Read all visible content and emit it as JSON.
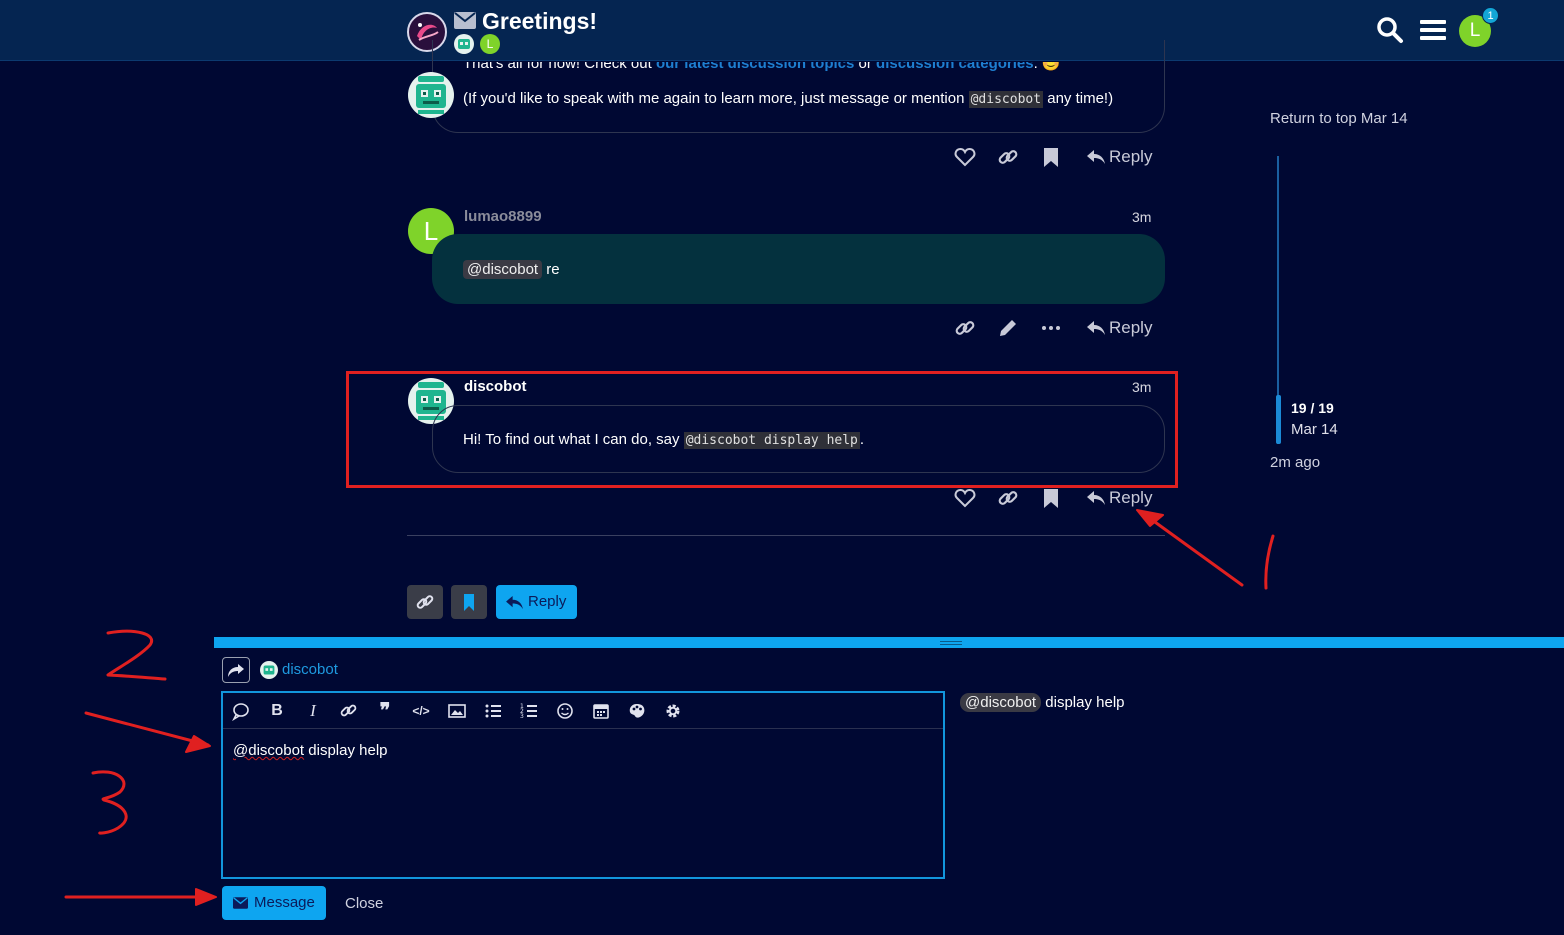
{
  "header": {
    "topic_title": "Greetings!",
    "participant_initial": "L",
    "user_initial": "L",
    "notification_count": "1",
    "icons": [
      "logo",
      "envelope-icon",
      "search-icon",
      "hamburger-menu-icon"
    ]
  },
  "posts": {
    "first": {
      "line1_prefix": "That's all for now! Check out ",
      "line1_link1": "our latest discussion topics",
      "line1_mid": " or ",
      "line1_link2": "discussion categories",
      "line1_suffix": ". 😊",
      "line2_prefix": "(If you'd like to speak with me again to learn more, just message or mention ",
      "line2_code": "@discobot",
      "line2_suffix": " any time!)",
      "reply_label": "Reply"
    },
    "second": {
      "username": "lumao8899",
      "avatar_initial": "L",
      "age": "3m",
      "mention": "@discobot",
      "text": " re",
      "reply_label": "Reply"
    },
    "third": {
      "username": "discobot",
      "age": "3m",
      "text_prefix": "Hi! To find out what I can do, say ",
      "code": "@discobot display help",
      "text_suffix": ".",
      "reply_label": "Reply"
    }
  },
  "timeline": {
    "return_label": "Return to top Mar 14",
    "position": "19 / 19",
    "date": "Mar 14",
    "ago": "2m ago"
  },
  "footer": {
    "reply_label": "Reply"
  },
  "composer": {
    "recipient": "discobot",
    "editor_mention": "@discobot",
    "editor_rest": " display help",
    "preview_mention": "@discobot",
    "preview_rest": " display help",
    "submit_label": "Message",
    "close_label": "Close"
  },
  "colors": {
    "background": "#000833",
    "header": "#052551",
    "accent": "#0ea5f0",
    "annotation_red": "#e02020",
    "user_avatar": "#7fd32a"
  }
}
